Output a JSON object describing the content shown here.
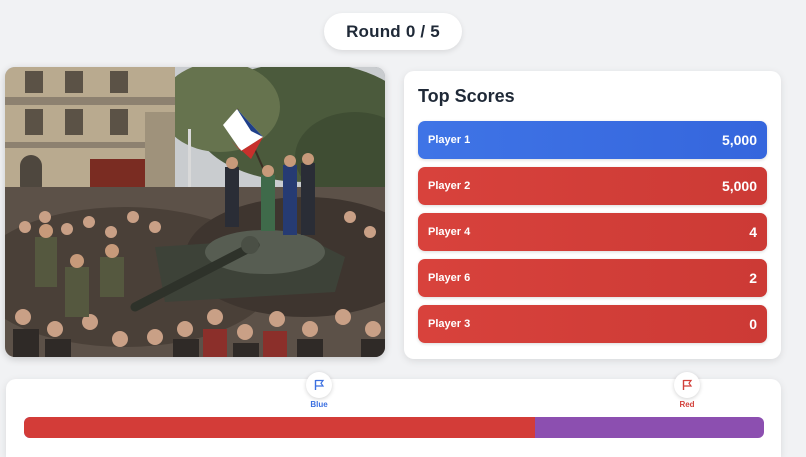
{
  "round": {
    "label": "Round 0 / 5"
  },
  "photo": {
    "subject": "crowd-photo"
  },
  "scoreboard": {
    "title": "Top Scores",
    "entries": [
      {
        "name": "Player 1",
        "score": "5,000",
        "team": "blue"
      },
      {
        "name": "Player 2",
        "score": "5,000",
        "team": "red"
      },
      {
        "name": "Player 4",
        "score": "4",
        "team": "red"
      },
      {
        "name": "Player 6",
        "score": "2",
        "team": "red"
      },
      {
        "name": "Player 3",
        "score": "0",
        "team": "red"
      }
    ]
  },
  "teams": {
    "blue": {
      "label": "Blue",
      "icon": "flag-icon",
      "color": "#3b6fe0"
    },
    "red": {
      "label": "Red",
      "icon": "flag-icon",
      "color": "#d2403a"
    }
  },
  "tug_of_war": {
    "red_fraction": 0.69,
    "red_color": "#d33c38",
    "remainder_color": "#8c4fb0"
  }
}
